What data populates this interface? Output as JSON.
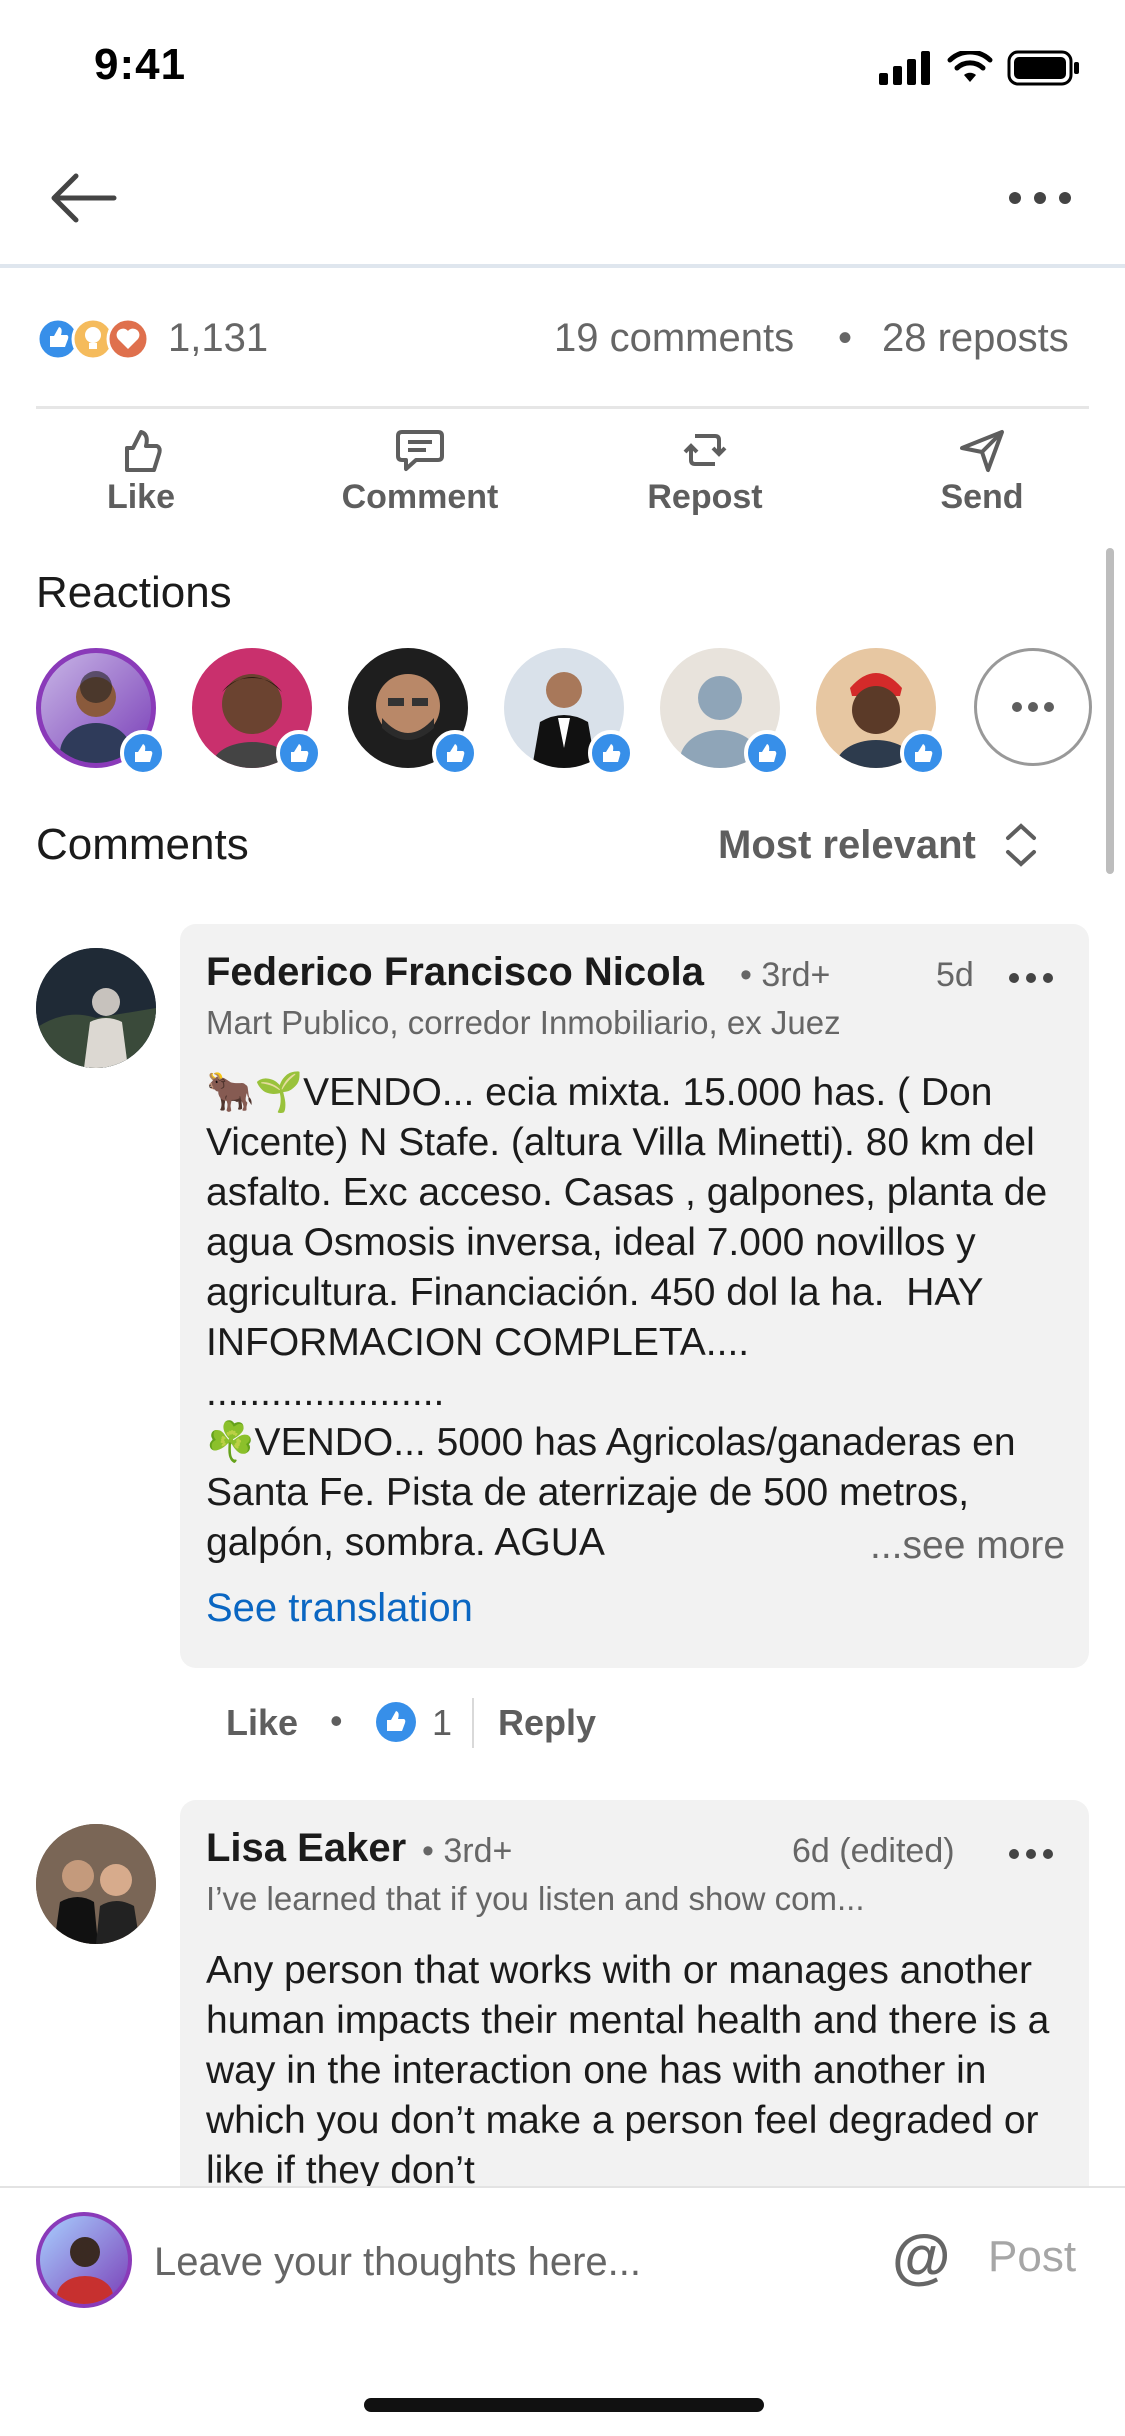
{
  "status_bar": {
    "time": "9:41"
  },
  "summary": {
    "reaction_count": "1,131",
    "comments": "19 comments",
    "separator": "•",
    "reposts": "28 reposts"
  },
  "actions": {
    "like": "Like",
    "comment": "Comment",
    "repost": "Repost",
    "send": "Send"
  },
  "reactions": {
    "title": "Reactions"
  },
  "comments_section": {
    "title": "Comments",
    "sort": "Most relevant"
  },
  "comments": [
    {
      "name": "Federico Francisco Nicola",
      "degree": "• 3rd+",
      "time": "5d",
      "headline": "Mart Publico, corredor Inmobiliario, ex Juez",
      "body": "🐂🌱VENDO... ecia mixta. 15.000 has. ( Don Vicente) N Stafe. (altura Villa Minetti). 80 km del asfalto. Exc acceso. Casas , galpones, planta de agua Osmosis inversa, ideal 7.000 novillos y agricultura. Financiación. 450 dol la ha.  HAY INFORMACION COMPLETA....\n......................\n☘️VENDO... 5000 has Agricolas/ganaderas en Santa Fe. Pista de aterrizaje de 500 metros, galpón, sombra. AGUA",
      "see_more": "...see more",
      "see_translation": "See translation",
      "like_label": "Like",
      "dot": "•",
      "reaction_count": "1",
      "reply_label": "Reply"
    },
    {
      "name": "Lisa Eaker",
      "degree": "• 3rd+",
      "time": "6d (edited)",
      "headline": "I’ve learned that if you listen and show com...",
      "body": "Any person that works with or manages another human impacts their mental health and there is a way in the interaction one has with another in which you don’t make a person feel degraded or like if they don’t"
    }
  ],
  "compose": {
    "placeholder": "Leave your thoughts here...",
    "mention": "@",
    "post": "Post"
  },
  "colors": {
    "link_blue": "#0a66c2",
    "like_blue": "#378fe9",
    "bubble_bg": "#f2f2f2"
  }
}
